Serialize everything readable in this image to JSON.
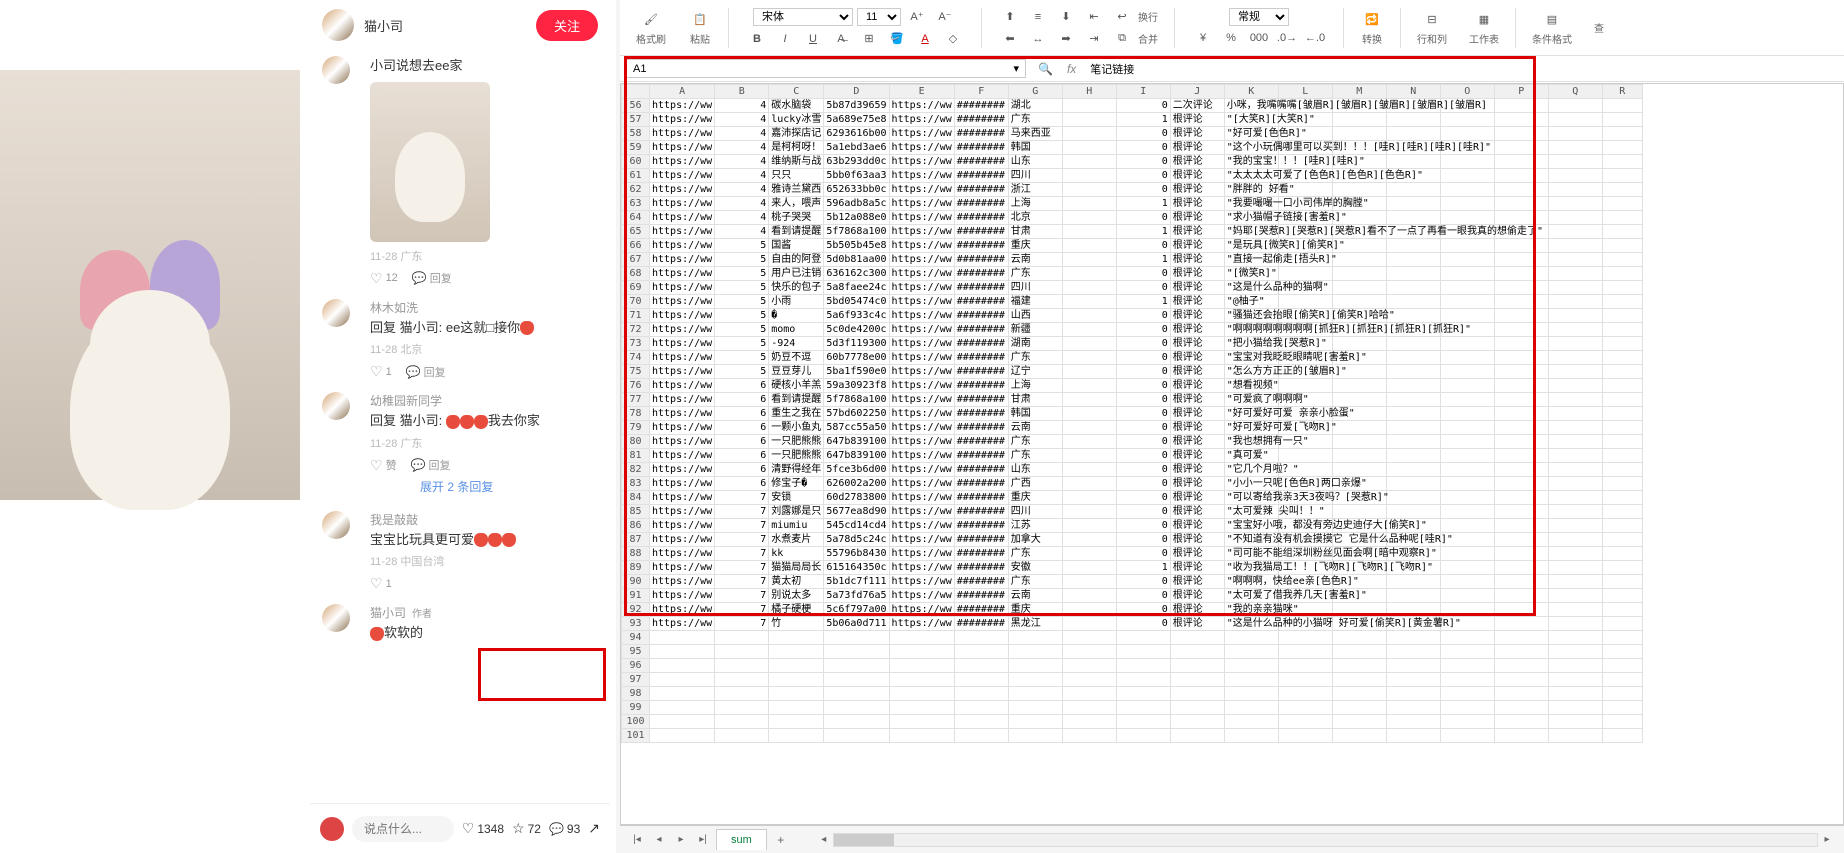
{
  "feed": {
    "header_user": "猫小司",
    "follow": "关注",
    "comments": [
      {
        "user": "",
        "text": "小司说想去ee家",
        "meta": "11-28 广东",
        "likes": "12",
        "reply": "回复",
        "has_photo": true
      },
      {
        "user": "林木如洗",
        "text": "回复 猫小司: ee这就□接你🍓",
        "meta": "11-28 北京",
        "likes": "1",
        "reply": "回复"
      },
      {
        "user": "幼稚园新同学",
        "text": "回复 猫小司: 🍓🍓🍓我去你家",
        "meta": "11-28 广东",
        "like_label": "赞",
        "reply": "回复",
        "expand": "展开 2 条回复"
      },
      {
        "user": "我是敲敲",
        "text": "宝宝比玩具更可爱🍓🍓🍓",
        "meta": "11-28 中国台湾",
        "like_label": "赞",
        "likes": "1"
      },
      {
        "user": "猫小司",
        "author": "作者",
        "text": "🍓软软的"
      }
    ],
    "footer": {
      "placeholder": "说点什么...",
      "likes": "1348",
      "stars": "72",
      "chats": "93"
    }
  },
  "ribbon": {
    "fmt_brush": "格式刷",
    "paste": "粘贴",
    "font": "宋体",
    "size": "11",
    "wrap": "换行",
    "normal": "常规",
    "convert": "转换",
    "rowcol": "行和列",
    "sheet": "工作表",
    "cond": "条件格式",
    "merge": "合并",
    "find": "查"
  },
  "fx": {
    "cell": "A1",
    "value": "笔记链接"
  },
  "cols": [
    "A",
    "B",
    "C",
    "D",
    "E",
    "F",
    "G",
    "H",
    "I",
    "J",
    "K",
    "L",
    "M",
    "N",
    "O",
    "P",
    "Q",
    "R"
  ],
  "rows": [
    {
      "n": 56,
      "A": "https://ww",
      "B": "4",
      "C": "碳水脑袋",
      "D": "5b87d39659",
      "E": "https://ww",
      "F": "########",
      "G": "湖北",
      "I": "0",
      "J": "二次评论",
      "K": "小咪，我嘴嘴嘴[皱眉R][皱眉R][皱眉R][皱眉R][皱眉R]"
    },
    {
      "n": 57,
      "A": "https://ww",
      "B": "4",
      "C": "lucky冰雪",
      "D": "5a689e75e8",
      "E": "https://ww",
      "F": "########",
      "G": "广东",
      "I": "1",
      "J": "根评论",
      "K": "\"[大笑R][大笑R]\""
    },
    {
      "n": 58,
      "A": "https://ww",
      "B": "4",
      "C": "嘉沛探店记",
      "D": "6293616b00",
      "E": "https://ww",
      "F": "########",
      "G": "马来西亚",
      "I": "0",
      "J": "根评论",
      "K": "\"好可爱[色色R]\""
    },
    {
      "n": 59,
      "A": "https://ww",
      "B": "4",
      "C": "是柯柯呀！",
      "D": "5a1ebd3ae6",
      "E": "https://ww",
      "F": "########",
      "G": "韩国",
      "I": "0",
      "J": "根评论",
      "K": "\"这个小玩偶哪里可以买到！！！[哇R][哇R][哇R][哇R]\""
    },
    {
      "n": 60,
      "A": "https://ww",
      "B": "4",
      "C": "维纳斯与战",
      "D": "63b293dd0c",
      "E": "https://ww",
      "F": "########",
      "G": "山东",
      "I": "0",
      "J": "根评论",
      "K": "\"我的宝宝！！！[哇R][哇R]\""
    },
    {
      "n": 61,
      "A": "https://ww",
      "B": "4",
      "C": "只只",
      "D": "5bb0f63aa3",
      "E": "https://ww",
      "F": "########",
      "G": "四川",
      "I": "0",
      "J": "根评论",
      "K": "\"太太太太可爱了[色色R][色色R][色色R]\""
    },
    {
      "n": 62,
      "A": "https://ww",
      "B": "4",
      "C": "雅诗兰黛西",
      "D": "652633bb0c",
      "E": "https://ww",
      "F": "########",
      "G": "浙江",
      "I": "0",
      "J": "根评论",
      "K": "\"胖胖的 好看\""
    },
    {
      "n": 63,
      "A": "https://ww",
      "B": "4",
      "C": "来人，喂声",
      "D": "596adb8a5c",
      "E": "https://ww",
      "F": "########",
      "G": "上海",
      "I": "1",
      "J": "根评论",
      "K": "\"我要嘬嘬一口小司伟岸的胸膛\""
    },
    {
      "n": 64,
      "A": "https://ww",
      "B": "4",
      "C": "桃子哭哭",
      "D": "5b12a088e0",
      "E": "https://ww",
      "F": "########",
      "G": "北京",
      "I": "0",
      "J": "根评论",
      "K": "\"求小猫帽子链接[害羞R]\""
    },
    {
      "n": 65,
      "A": "https://ww",
      "B": "4",
      "C": "看到请提醒",
      "D": "5f7868a100",
      "E": "https://ww",
      "F": "########",
      "G": "甘肃",
      "I": "1",
      "J": "根评论",
      "K": "\"妈耶[哭惹R][哭惹R][哭惹R]看不了一点了再看一眼我真的想偷走了\""
    },
    {
      "n": 66,
      "A": "https://ww",
      "B": "5",
      "C": "国酱",
      "D": "5b505b45e8",
      "E": "https://ww",
      "F": "########",
      "G": "重庆",
      "I": "0",
      "J": "根评论",
      "K": "\"是玩具[微笑R][偷笑R]\""
    },
    {
      "n": 67,
      "A": "https://ww",
      "B": "5",
      "C": "自由的阿登",
      "D": "5d0b81aa00",
      "E": "https://ww",
      "F": "########",
      "G": "云南",
      "I": "1",
      "J": "根评论",
      "K": "\"直接一起偷走[捂头R]\""
    },
    {
      "n": 68,
      "A": "https://ww",
      "B": "5",
      "C": "用户已注销",
      "D": "636162c300",
      "E": "https://ww",
      "F": "########",
      "G": "广东",
      "I": "0",
      "J": "根评论",
      "K": "\"[微笑R]\""
    },
    {
      "n": 69,
      "A": "https://ww",
      "B": "5",
      "C": "快乐的包子",
      "D": "5a8faee24c",
      "E": "https://ww",
      "F": "########",
      "G": "四川",
      "I": "0",
      "J": "根评论",
      "K": "\"这是什么品种的猫啊\""
    },
    {
      "n": 70,
      "A": "https://ww",
      "B": "5",
      "C": "小雨",
      "D": "5bd05474c0",
      "E": "https://ww",
      "F": "########",
      "G": "福建",
      "I": "1",
      "J": "根评论",
      "K": "\"@柚子\""
    },
    {
      "n": 71,
      "A": "https://ww",
      "B": "5",
      "C": "�",
      "D": "5a6f933c4c",
      "E": "https://ww",
      "F": "########",
      "G": "山西",
      "I": "0",
      "J": "根评论",
      "K": "\"骚猫还会抬眼[偷笑R][偷笑R]哈哈\""
    },
    {
      "n": 72,
      "A": "https://ww",
      "B": "5",
      "C": "momo",
      "D": "5c0de4200c",
      "E": "https://ww",
      "F": "########",
      "G": "新疆",
      "I": "0",
      "J": "根评论",
      "K": "\"啊啊啊啊啊啊啊啊[抓狂R][抓狂R][抓狂R][抓狂R]\""
    },
    {
      "n": 73,
      "A": "https://ww",
      "B": "5",
      "C": "",
      "CS": "-924",
      "D": "5d3f119300",
      "E": "https://ww",
      "F": "########",
      "G": "湖南",
      "I": "0",
      "J": "根评论",
      "K": "\"把小猫给我[哭惹R]\""
    },
    {
      "n": 74,
      "A": "https://ww",
      "B": "5",
      "C": "奶豆不逗",
      "D": "60b7778e00",
      "E": "https://ww",
      "F": "########",
      "G": "广东",
      "I": "0",
      "J": "根评论",
      "K": "\"宝宝对我眨眨眼睛呢[害羞R]\""
    },
    {
      "n": 75,
      "A": "https://ww",
      "B": "5",
      "C": "豆豆芽儿",
      "D": "5ba1f590e0",
      "E": "https://ww",
      "F": "########",
      "G": "辽宁",
      "I": "0",
      "J": "根评论",
      "K": "\"怎么方方正正的[皱眉R]\""
    },
    {
      "n": 76,
      "A": "https://ww",
      "B": "6",
      "C": "硬核小羊羔",
      "D": "59a30923f8",
      "E": "https://ww",
      "F": "########",
      "G": "上海",
      "I": "0",
      "J": "根评论",
      "K": "\"想看视频\""
    },
    {
      "n": 77,
      "A": "https://ww",
      "B": "6",
      "C": "看到请提醒",
      "D": "5f7868a100",
      "E": "https://ww",
      "F": "########",
      "G": "甘肃",
      "I": "0",
      "J": "根评论",
      "K": "\"可爱疯了啊啊啊\""
    },
    {
      "n": 78,
      "A": "https://ww",
      "B": "6",
      "C": "重生之我在",
      "D": "57bd602250",
      "E": "https://ww",
      "F": "########",
      "G": "韩国",
      "I": "0",
      "J": "根评论",
      "K": "\"好可爱好可爱 亲亲小脸蛋\""
    },
    {
      "n": 79,
      "A": "https://ww",
      "B": "6",
      "C": "一颗小鱼丸",
      "D": "587cc55a50",
      "E": "https://ww",
      "F": "########",
      "G": "云南",
      "I": "0",
      "J": "根评论",
      "K": "\"好可爱好可爱[飞吻R]\""
    },
    {
      "n": 80,
      "A": "https://ww",
      "B": "6",
      "C": "一只肥熊熊",
      "D": "647b839100",
      "E": "https://ww",
      "F": "########",
      "G": "广东",
      "I": "0",
      "J": "根评论",
      "K": "\"我也想拥有一只\""
    },
    {
      "n": 81,
      "A": "https://ww",
      "B": "6",
      "C": "一只肥熊熊",
      "D": "647b839100",
      "E": "https://ww",
      "F": "########",
      "G": "广东",
      "I": "0",
      "J": "根评论",
      "K": "\"真可爱\""
    },
    {
      "n": 82,
      "A": "https://ww",
      "B": "6",
      "C": "清野得经年",
      "D": "5fce3b6d00",
      "E": "https://ww",
      "F": "########",
      "G": "山东",
      "I": "0",
      "J": "根评论",
      "K": "\"它几个月啦？\""
    },
    {
      "n": 83,
      "A": "https://ww",
      "B": "6",
      "C": "修宝子�",
      "D": "626002a200",
      "E": "https://ww",
      "F": "########",
      "G": "广西",
      "I": "0",
      "J": "根评论",
      "K": "\"小小一只呢[色色R]两口亲爆\""
    },
    {
      "n": 84,
      "A": "https://ww",
      "B": "7",
      "C": "安锁",
      "D": "60d2783800",
      "E": "https://ww",
      "F": "########",
      "G": "重庆",
      "I": "0",
      "J": "根评论",
      "K": "\"可以寄给我亲3天3夜吗？[哭惹R]\""
    },
    {
      "n": 85,
      "A": "https://ww",
      "B": "7",
      "C": "刘露娜是只",
      "D": "5677ea8d90",
      "E": "https://ww",
      "F": "########",
      "G": "四川",
      "I": "0",
      "J": "根评论",
      "K": "\"太可爱辣 尖叫！！\""
    },
    {
      "n": 86,
      "A": "https://ww",
      "B": "7",
      "C": "miumiu",
      "D": "545cd14cd4",
      "E": "https://ww",
      "F": "########",
      "G": "江苏",
      "I": "0",
      "J": "根评论",
      "K": "\"宝宝好小哦，都没有旁边史迪仔大[偷笑R]\""
    },
    {
      "n": 87,
      "A": "https://ww",
      "B": "7",
      "C": "水煮麦片",
      "D": "5a78d5c24c",
      "E": "https://ww",
      "F": "########",
      "G": "加拿大",
      "I": "0",
      "J": "根评论",
      "K": "\"不知道有没有机会摸摸它 它是什么品种呢[哇R]\""
    },
    {
      "n": 88,
      "A": "https://ww",
      "B": "7",
      "C": "kk",
      "D": "55796b8430",
      "E": "https://ww",
      "F": "########",
      "G": "广东",
      "I": "0",
      "J": "根评论",
      "K": "\"司可能不能组深圳粉丝见面会啊[暗中观察R]\""
    },
    {
      "n": 89,
      "A": "https://ww",
      "B": "7",
      "C": "猫猫局局长",
      "D": "615164350c",
      "E": "https://ww",
      "F": "########",
      "G": "安徽",
      "I": "1",
      "J": "根评论",
      "K": "\"收为我猫局工！！[飞吻R][飞吻R][飞吻R]\""
    },
    {
      "n": 90,
      "A": "https://ww",
      "B": "7",
      "C": "黄太初",
      "D": "5b1dc7f111",
      "E": "https://ww",
      "F": "########",
      "G": "广东",
      "I": "0",
      "J": "根评论",
      "K": "\"啊啊啊，快给ee亲[色色R]\""
    },
    {
      "n": 91,
      "A": "https://ww",
      "B": "7",
      "C": "别说太多",
      "D": "5a73fd76a5",
      "E": "https://ww",
      "F": "########",
      "G": "云南",
      "I": "0",
      "J": "根评论",
      "K": "\"太可爱了借我养几天[害羞R]\""
    },
    {
      "n": 92,
      "A": "https://ww",
      "B": "7",
      "C": "橘子硬梗",
      "D": "5c6f797a00",
      "E": "https://ww",
      "F": "########",
      "G": "重庆",
      "I": "0",
      "J": "根评论",
      "K": "\"我的亲亲猫咪\""
    },
    {
      "n": 93,
      "A": "https://ww",
      "B": "7",
      "C": "竹",
      "D": "5b06a0d711",
      "E": "https://ww",
      "F": "########",
      "G": "黑龙江",
      "I": "0",
      "J": "根评论",
      "K": "\"这是什么品种的小猫呀 好可爱[偷笑R][黄金薯R]\""
    },
    {
      "n": 94
    },
    {
      "n": 95
    },
    {
      "n": 96
    },
    {
      "n": 97
    },
    {
      "n": 98
    },
    {
      "n": 99
    },
    {
      "n": 100
    },
    {
      "n": 101
    }
  ],
  "tab": "sum"
}
